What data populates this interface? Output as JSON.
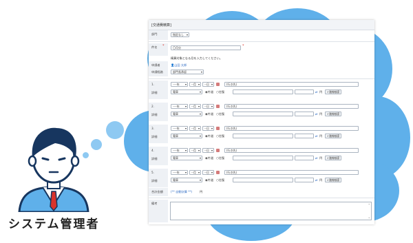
{
  "illustration": {
    "caption": "システム管理者"
  },
  "form": {
    "title": "[交通費精算]",
    "fields": {
      "division_label": "部門",
      "division_value": "指定なし",
      "subject_label": "件名",
      "subject_value": "〇月分",
      "subject_hint": "精算対象となる月を入力してください。",
      "applicant_label": "申請者",
      "applicant_value": "山田 太郎",
      "route_label": "申請経路",
      "route_value": "部門長承認"
    },
    "entries": [
      {
        "index": "1.",
        "year": "----年",
        "month": "--月",
        "day": "--日",
        "memo": "(行き先)",
        "amount_label": "詳細",
        "type": "電車",
        "radio1": "片道",
        "radio2": "往復",
        "currency": "円",
        "lookup": "←路線検索"
      },
      {
        "index": "2.",
        "year": "----年",
        "month": "--月",
        "day": "--日",
        "memo": "(行き先)",
        "amount_label": "詳細",
        "type": "電車",
        "radio1": "片道",
        "radio2": "往復",
        "currency": "円",
        "lookup": "←路線検索"
      },
      {
        "index": "3.",
        "year": "----年",
        "month": "--月",
        "day": "--日",
        "memo": "(行き先)",
        "amount_label": "詳細",
        "type": "電車",
        "radio1": "片道",
        "radio2": "往復",
        "currency": "円",
        "lookup": "←路線検索"
      },
      {
        "index": "4.",
        "year": "----年",
        "month": "--月",
        "day": "--日",
        "memo": "(行き先)",
        "amount_label": "詳細",
        "type": "電車",
        "radio1": "片道",
        "radio2": "往復",
        "currency": "円",
        "lookup": "←路線検索"
      },
      {
        "index": "5.",
        "year": "----年",
        "month": "--月",
        "day": "--日",
        "memo": "(行き先)",
        "amount_label": "詳細",
        "type": "電車",
        "radio1": "片道",
        "radio2": "往復",
        "currency": "円",
        "lookup": "←路線検索"
      }
    ],
    "total": {
      "label": "合計金額",
      "value": "(** 自動計算 **)",
      "currency": "円"
    },
    "remarks_label": "備考",
    "colors": {
      "cloud": "#5fb0ea",
      "label_bg": "#eef1f5",
      "required": "#d9332c",
      "link": "#2f6cc4"
    }
  }
}
